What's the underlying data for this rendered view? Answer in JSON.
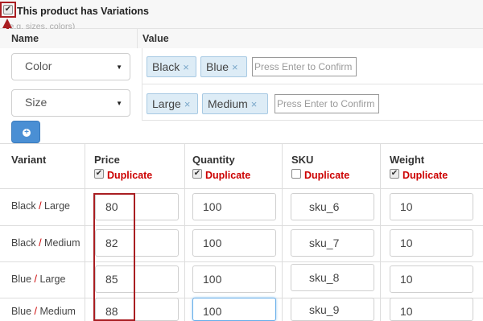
{
  "variations": {
    "checked": true,
    "label": "This product has Variations",
    "hint": "(e.g. sizes, colors)"
  },
  "options": {
    "name_header": "Name",
    "value_header": "Value",
    "rows": [
      {
        "name": "Color",
        "tags": [
          "Black",
          "Blue"
        ],
        "placeholder": "Press Enter to Confirm"
      },
      {
        "name": "Size",
        "tags": [
          "Large",
          "Medium"
        ],
        "placeholder": "Press Enter to Confirm"
      }
    ],
    "remove_glyph": "×",
    "add_icon": "plus-circle-icon"
  },
  "table": {
    "headers": {
      "variant": "Variant",
      "price": "Price",
      "quantity": "Quantity",
      "sku": "SKU",
      "weight": "Weight"
    },
    "duplicate_label": "Duplicate",
    "duplicate_checked": {
      "price": true,
      "quantity": true,
      "sku": false,
      "weight": true
    },
    "slash": "/",
    "rows": [
      {
        "color": "Black",
        "size": "Large",
        "price": "80",
        "quantity": "100",
        "sku": "sku_6",
        "weight": "10"
      },
      {
        "color": "Black",
        "size": "Medium",
        "price": "82",
        "quantity": "100",
        "sku": "sku_7",
        "weight": "10"
      },
      {
        "color": "Blue",
        "size": "Large",
        "price": "85",
        "quantity": "100",
        "sku": "sku_8",
        "weight": "10"
      },
      {
        "color": "Blue",
        "size": "Medium",
        "price": "88",
        "quantity": "100",
        "sku": "sku_9",
        "weight": "10"
      }
    ]
  },
  "colors": {
    "highlight": "#a91e22",
    "duplicate_text": "#cc0000",
    "button": "#4a8fd4",
    "tag_bg": "#ddecf6"
  }
}
